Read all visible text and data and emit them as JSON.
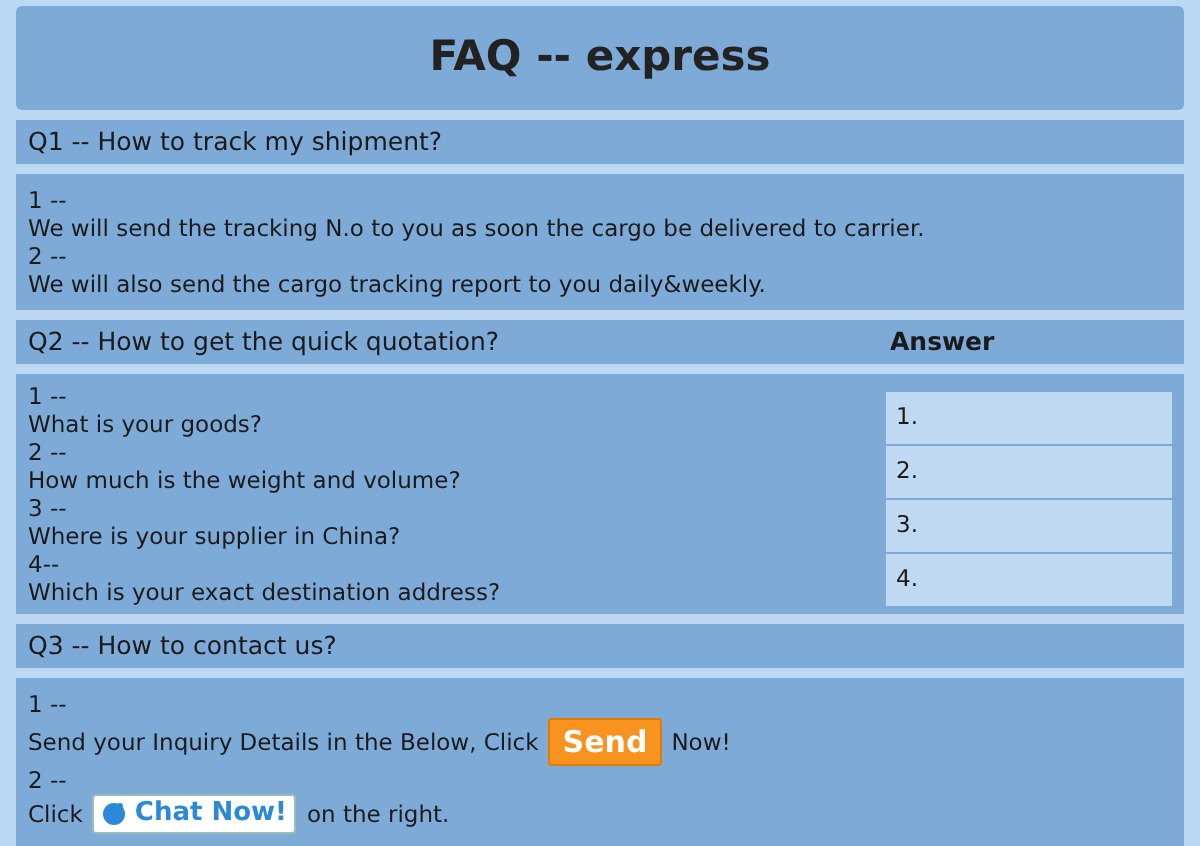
{
  "title": "FAQ -- express",
  "sections": [
    {
      "question": "Q1 -- How to track my shipment?",
      "lines": [
        {
          "parts": [
            {
              "kind": "text",
              "text": "1 --"
            }
          ]
        },
        {
          "parts": [
            {
              "kind": "text",
              "text": "We will send the tracking N.o to you as soon the cargo be delivered to carrier."
            }
          ]
        },
        {
          "parts": [
            {
              "kind": "text",
              "text": "2 --"
            }
          ]
        },
        {
          "parts": [
            {
              "kind": "text",
              "text": "We will also send the cargo tracking report to you daily&weekly."
            }
          ]
        }
      ]
    },
    {
      "question": "Q2 -- How to get the quick quotation?",
      "answer_header": "Answer",
      "answers": [
        "1.",
        "2.",
        "3.",
        "4."
      ],
      "lines": [
        {
          "parts": [
            {
              "kind": "text",
              "text": "1 --"
            }
          ]
        },
        {
          "parts": [
            {
              "kind": "text",
              "text": "What is your goods?"
            }
          ]
        },
        {
          "parts": [
            {
              "kind": "text",
              "text": "2 --"
            }
          ]
        },
        {
          "parts": [
            {
              "kind": "text",
              "text": "How much is the weight and volume?"
            }
          ]
        },
        {
          "parts": [
            {
              "kind": "text",
              "text": "3 --"
            }
          ]
        },
        {
          "parts": [
            {
              "kind": "text",
              "text": "Where is your supplier in China?"
            }
          ]
        },
        {
          "parts": [
            {
              "kind": "text",
              "text": "4--"
            }
          ]
        },
        {
          "parts": [
            {
              "kind": "text",
              "text": "Which is your exact destination address?"
            }
          ]
        }
      ]
    },
    {
      "question": "Q3 -- How to contact us?",
      "lines": [
        {
          "parts": [
            {
              "kind": "text",
              "text": "1 --"
            }
          ]
        },
        {
          "parts": [
            {
              "kind": "text",
              "text": "Send your Inquiry Details in the Below, Click"
            },
            {
              "kind": "send",
              "text": "Send"
            },
            {
              "kind": "text",
              "text": "Now!"
            }
          ]
        },
        {
          "parts": [
            {
              "kind": "text",
              "text": "2 --"
            }
          ]
        },
        {
          "parts": [
            {
              "kind": "text",
              "text": "Click"
            },
            {
              "kind": "chat",
              "text": "Chat Now!"
            },
            {
              "kind": "text",
              "text": "on the right."
            }
          ]
        }
      ]
    }
  ]
}
